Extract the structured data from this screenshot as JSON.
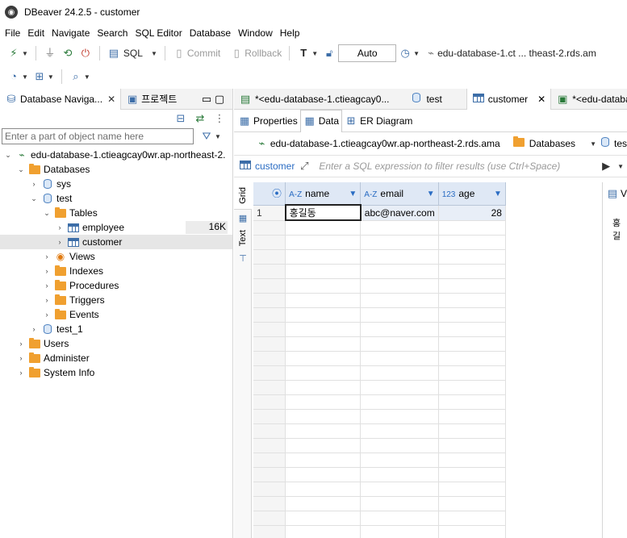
{
  "window": {
    "title": "DBeaver 24.2.5 - customer"
  },
  "menu": [
    "File",
    "Edit",
    "Navigate",
    "Search",
    "SQL Editor",
    "Database",
    "Window",
    "Help"
  ],
  "toolbar": {
    "sql_label": "SQL",
    "commit_label": "Commit",
    "rollback_label": "Rollback",
    "transaction_mode": "Auto",
    "connection": "edu-database-1.ct ... theast-2.rds.am"
  },
  "navigator": {
    "tab_label": "Database Naviga...",
    "projects_tab_label": "프로젝트",
    "filter_placeholder": "Enter a part of object name here",
    "connection_node": "edu-database-1.ctieagcay0wr.ap-northeast-2.",
    "databases_label": "Databases",
    "sys_label": "sys",
    "test_label": "test",
    "tables_label": "Tables",
    "employee_label": "employee",
    "employee_size": "16K",
    "customer_label": "customer",
    "views_label": "Views",
    "indexes_label": "Indexes",
    "procedures_label": "Procedures",
    "triggers_label": "Triggers",
    "events_label": "Events",
    "test1_label": "test_1",
    "users_label": "Users",
    "administer_label": "Administer",
    "sysinfo_label": "System Info"
  },
  "editor": {
    "tabs": [
      "*<edu-database-1.ctieagcay0...",
      "test",
      "customer",
      "*<edu-databa"
    ],
    "subtabs": [
      "Properties",
      "Data",
      "ER Diagram"
    ],
    "path_connection": "edu-database-1.ctieagcay0wr.ap-northeast-2.rds.ama",
    "path_databases": "Databases",
    "path_tail": "tes",
    "filter_table": "customer",
    "filter_placeholder": "Enter a SQL expression to filter results (use Ctrl+Space)",
    "vtab_grid": "Grid",
    "vtab_text": "Text",
    "right_panel_letter": "V",
    "right_panel_value": "홍길"
  },
  "grid": {
    "columns": [
      {
        "type": "A-Z",
        "name": "name"
      },
      {
        "type": "A-Z",
        "name": "email"
      },
      {
        "type": "123",
        "name": "age"
      }
    ],
    "rows": [
      {
        "num": "1",
        "name": "홍길동",
        "email": "abc@naver.com",
        "age": "28"
      }
    ]
  }
}
